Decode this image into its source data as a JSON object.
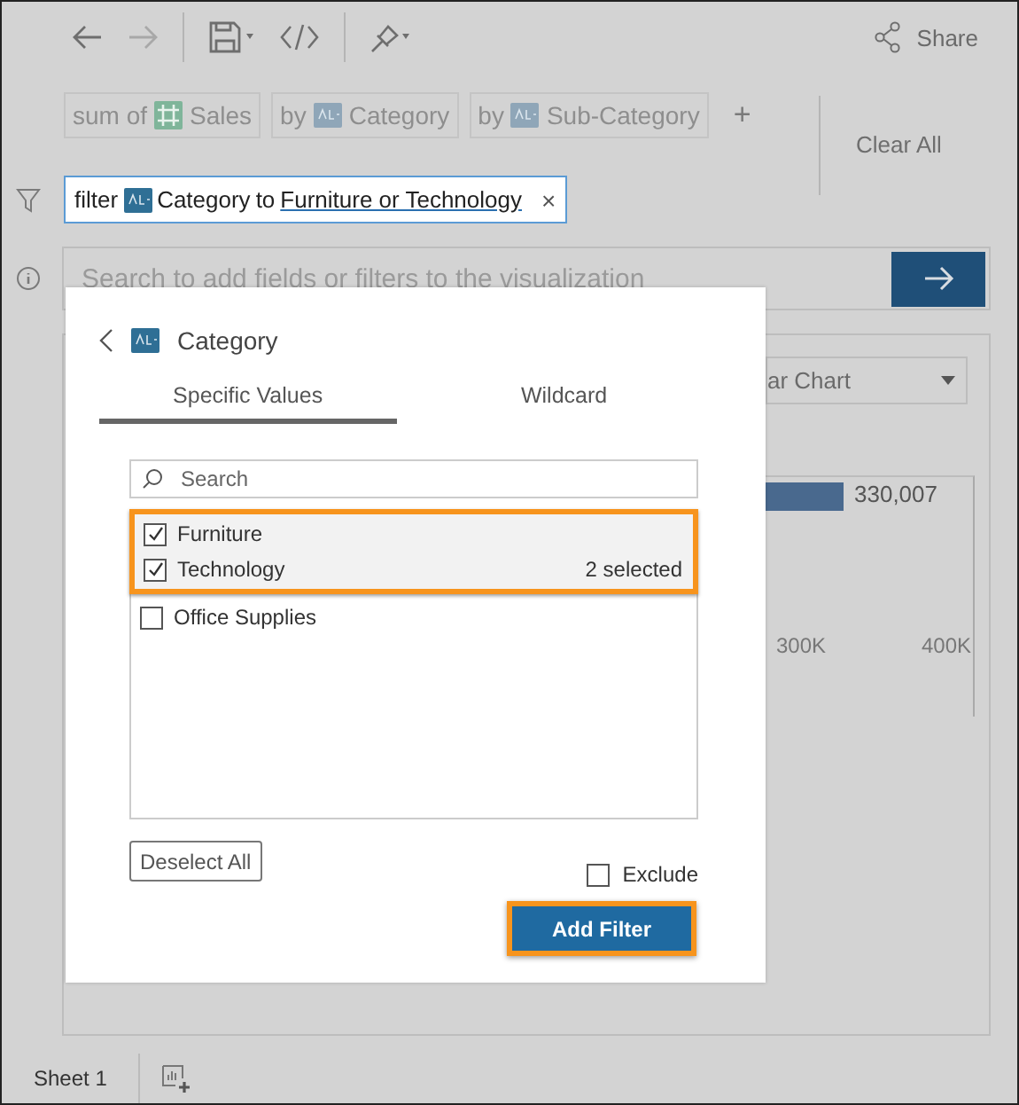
{
  "toolbar": {
    "share_label": "Share"
  },
  "shelf": {
    "pills": [
      {
        "prefix": "sum of",
        "kind": "measure",
        "field": "Sales"
      },
      {
        "prefix": "by",
        "kind": "dimension",
        "field": "Category"
      },
      {
        "prefix": "by",
        "kind": "dimension",
        "field": "Sub-Category"
      }
    ],
    "add_label": "+",
    "clear_label": "Clear All"
  },
  "filter_field": {
    "prefix": "filter",
    "field": "Category",
    "connector": "to",
    "value": "Furniture or Technology",
    "clear_label": "×"
  },
  "ask": {
    "placeholder": "Search to add fields or filters to the visualization"
  },
  "viz": {
    "chart_type": "ar Chart",
    "bar_label": "330,007",
    "axis_ticks": [
      "300K",
      "400K"
    ]
  },
  "popup": {
    "title": "Category",
    "tabs": [
      {
        "label": "Specific Values",
        "selected": true
      },
      {
        "label": "Wildcard",
        "selected": false
      }
    ],
    "search": {
      "placeholder": "Search"
    },
    "values": [
      {
        "label": "Furniture",
        "checked": true
      },
      {
        "label": "Technology",
        "checked": true
      },
      {
        "label": "Office Supplies",
        "checked": false
      }
    ],
    "selection_count": "2 selected",
    "deselect_label": "Deselect All",
    "exclude": {
      "label": "Exclude",
      "checked": false
    },
    "submit_label": "Add Filter"
  },
  "sheets": [
    {
      "label": "Sheet 1"
    }
  ]
}
